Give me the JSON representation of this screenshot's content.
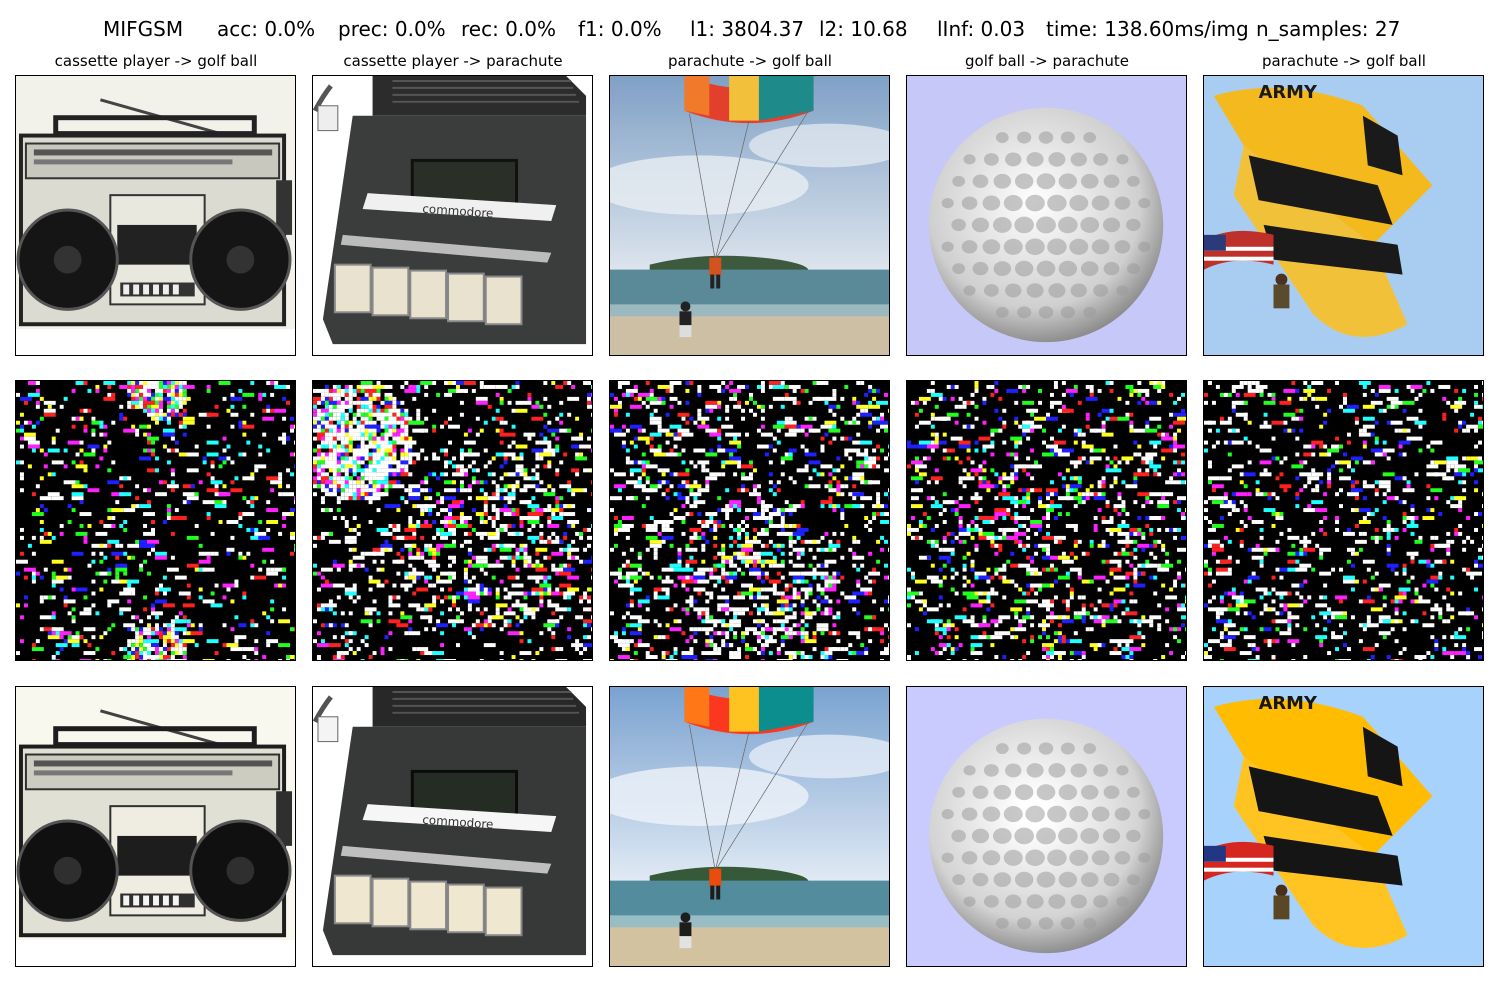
{
  "header": {
    "method": "MIFGSM",
    "acc": "acc: 0.0%",
    "prec": "prec: 0.0%",
    "rec": "rec: 0.0%",
    "f1": "f1: 0.0%",
    "l1": "l1: 3804.37",
    "l2": "l2: 10.68",
    "linf": "lInf: 0.03",
    "time": "time: 138.60ms/img",
    "n_samples": "n_samples: 27"
  },
  "columns": [
    {
      "title": "cassette player -> golf ball",
      "subject": "boombox"
    },
    {
      "title": "cassette player -> parachute",
      "subject": "cassette-recorder"
    },
    {
      "title": "parachute -> golf ball",
      "subject": "beach-parasail"
    },
    {
      "title": "golf ball -> parachute",
      "subject": "golf-ball"
    },
    {
      "title": "parachute -> golf ball",
      "subject": "army-parachute"
    }
  ],
  "image_texts": {
    "recorder_brand": "commodore",
    "parachute_text": "ARMY"
  },
  "rows": [
    "original",
    "perturbation",
    "adversarial"
  ]
}
